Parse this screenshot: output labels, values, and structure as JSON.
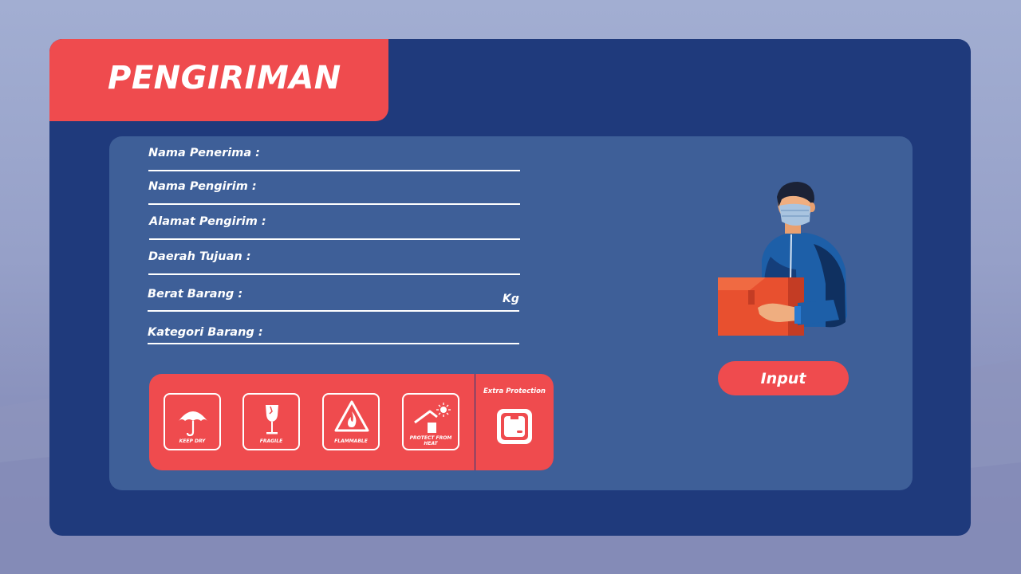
{
  "form": {
    "title": "PENGIRIMAN",
    "fields": [
      {
        "label": "Nama Penerima :",
        "value": ""
      },
      {
        "label": "Nama Pengirim :",
        "value": ""
      },
      {
        "label": "Alamat Pengirim :",
        "value": ""
      },
      {
        "label": "Daerah Tujuan :",
        "value": ""
      },
      {
        "label": "Berat Barang :",
        "value": "",
        "unit": "Kg"
      },
      {
        "label": "Kategori Barang :",
        "value": ""
      }
    ],
    "categories": [
      {
        "label": "KEEP DRY",
        "icon": "umbrella-icon"
      },
      {
        "label": "FRAGILE",
        "icon": "broken-glass-icon"
      },
      {
        "label": "FLAMMABLE",
        "icon": "fire-warning-icon"
      },
      {
        "label": "PROTECT FROM HEAT",
        "icon": "sun-house-icon"
      }
    ],
    "extra": {
      "label": "Extra Protection",
      "icon": "package-box-icon"
    },
    "submit_label": "Input"
  },
  "colors": {
    "accent": "#ef4b4e",
    "card": "#1f3a7c",
    "panel": "#3e5f98"
  }
}
